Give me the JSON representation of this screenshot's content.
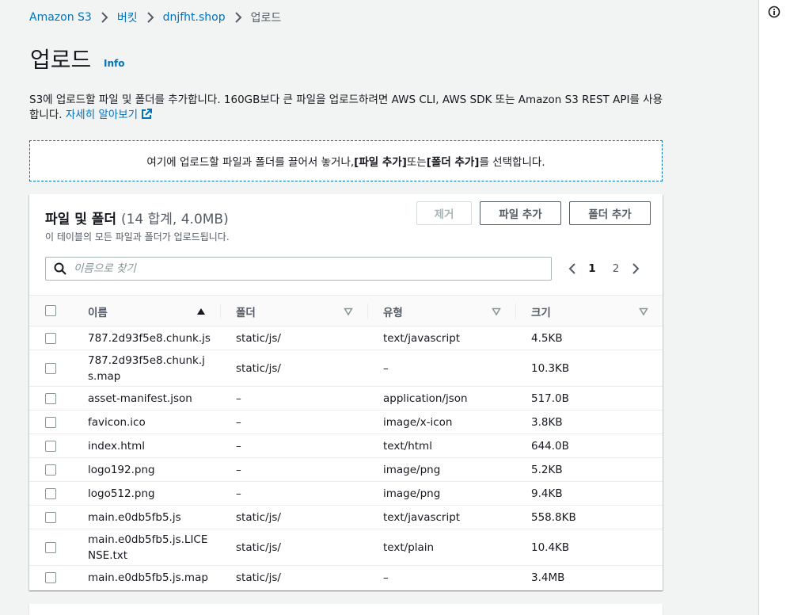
{
  "breadcrumb": {
    "items": [
      "Amazon S3",
      "버킷",
      "dnjfht.shop"
    ],
    "current": "업로드"
  },
  "page": {
    "title": "업로드",
    "info_label": "Info",
    "description": "S3에 업로드할 파일 및 폴더를 추가합니다. 160GB보다 큰 파일을 업로드하려면 AWS CLI, AWS SDK 또는 Amazon S3 REST API를 사용합니다.",
    "learn_more": "자세히 알아보기"
  },
  "dropzone": {
    "text_before": "여기에 업로드할 파일과 폴더를 끌어서 놓거나, ",
    "add_files": "[파일 추가]",
    "text_middle": " 또는 ",
    "add_folder": "[폴더 추가]",
    "text_after": "를 선택합니다."
  },
  "panel": {
    "title": "파일 및 폴더",
    "count": "(14 합계, 4.0MB)",
    "subtitle": "이 테이블의 모든 파일과 폴더가 업로드됩니다.",
    "remove_label": "제거",
    "add_files_label": "파일 추가",
    "add_folder_label": "폴더 추가"
  },
  "search": {
    "placeholder": "이름으로 찾기",
    "value": ""
  },
  "pagination": {
    "pages": [
      "1",
      "2"
    ],
    "current": "1"
  },
  "table": {
    "columns": [
      "이름",
      "폴더",
      "유형",
      "크기"
    ],
    "sort_column": "이름",
    "sort_direction": "ascending",
    "rows": [
      {
        "name": "787.2d93f5e8.chunk.js",
        "folder": "static/js/",
        "type": "text/javascript",
        "size": "4.5KB"
      },
      {
        "name": "787.2d93f5e8.chunk.js.map",
        "folder": "static/js/",
        "type": "–",
        "size": "10.3KB"
      },
      {
        "name": "asset-manifest.json",
        "folder": "–",
        "type": "application/json",
        "size": "517.0B"
      },
      {
        "name": "favicon.ico",
        "folder": "–",
        "type": "image/x-icon",
        "size": "3.8KB"
      },
      {
        "name": "index.html",
        "folder": "–",
        "type": "text/html",
        "size": "644.0B"
      },
      {
        "name": "logo192.png",
        "folder": "–",
        "type": "image/png",
        "size": "5.2KB"
      },
      {
        "name": "logo512.png",
        "folder": "–",
        "type": "image/png",
        "size": "9.4KB"
      },
      {
        "name": "main.e0db5fb5.js",
        "folder": "static/js/",
        "type": "text/javascript",
        "size": "558.8KB"
      },
      {
        "name": "main.e0db5fb5.js.LICENSE.txt",
        "folder": "static/js/",
        "type": "text/plain",
        "size": "10.4KB"
      },
      {
        "name": "main.e0db5fb5.js.map",
        "folder": "static/js/",
        "type": "–",
        "size": "3.4MB"
      }
    ]
  },
  "colors": {
    "link": "#0073bb",
    "text": "#16191f",
    "muted": "#545b64",
    "background": "#f2f3f3",
    "border": "#eaeded"
  }
}
